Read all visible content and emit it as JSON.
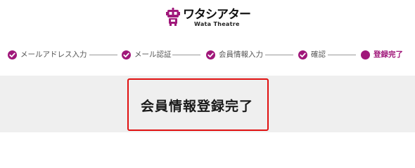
{
  "header": {
    "logo_text": "ワタシアター",
    "logo_subtext": "Wata Theatre"
  },
  "steps": [
    {
      "label": "メールアドレス入力",
      "state": "done"
    },
    {
      "label": "メール認証",
      "state": "done"
    },
    {
      "label": "会員情報入力",
      "state": "done"
    },
    {
      "label": "確認",
      "state": "done"
    },
    {
      "label": "登録完了",
      "state": "current"
    }
  ],
  "main": {
    "title": "会員情報登録完了"
  },
  "colors": {
    "accent": "#a0177a",
    "highlight_border": "#e01010",
    "banner_bg": "#efefef"
  }
}
